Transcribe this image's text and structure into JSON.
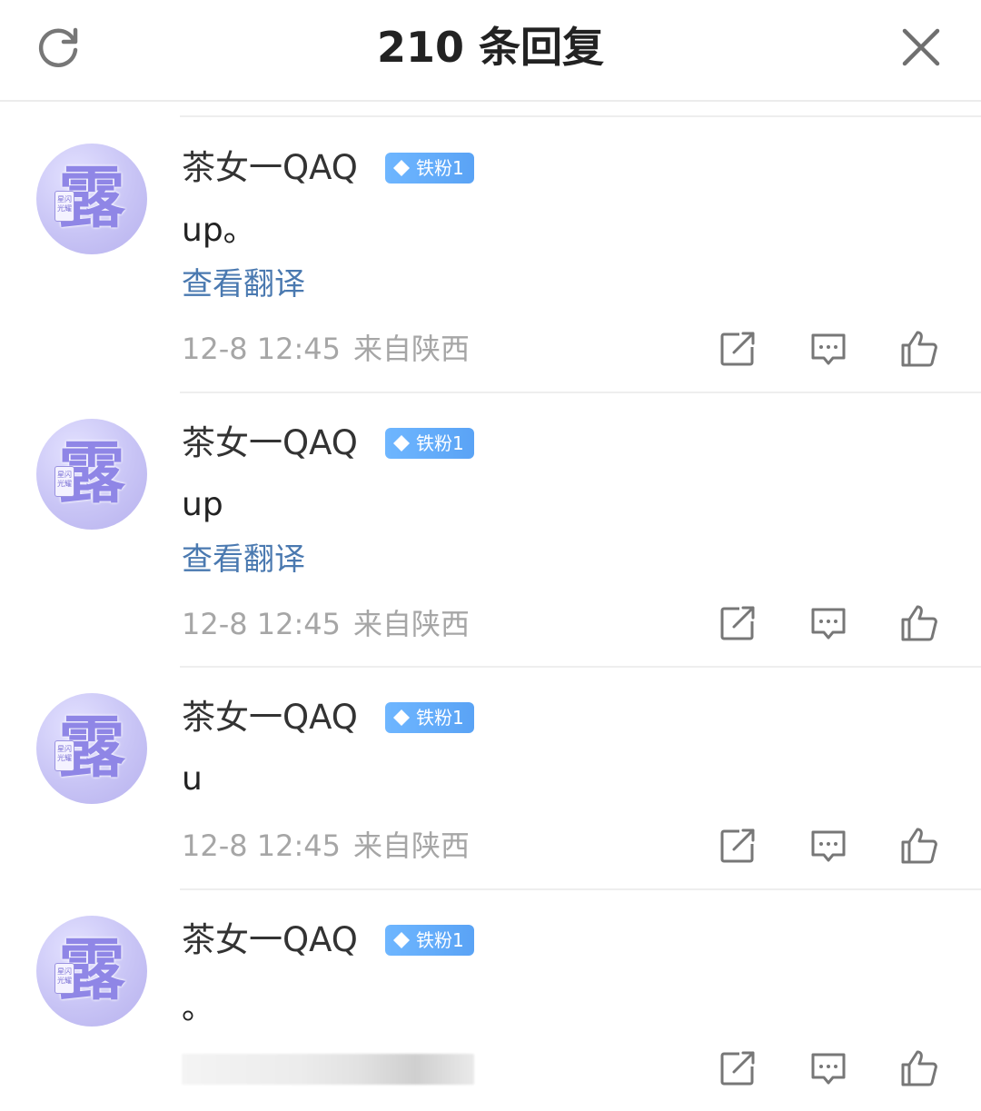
{
  "header": {
    "title": "210 条回复",
    "refresh_icon": "refresh-icon",
    "close_icon": "close-icon"
  },
  "colors": {
    "badge": "#5aa3f5",
    "link": "#4a79b0",
    "meta": "#a6a6a6",
    "avatar": "#c8c4f5"
  },
  "comments": [
    {
      "username": "茶女一QAQ",
      "badge": "铁粉1",
      "avatar_glyph": "露",
      "avatar_tag": "星闪光耀",
      "content": "up。",
      "translate": "查看翻译",
      "time": "12-8 12:45",
      "location": "来自陕西"
    },
    {
      "username": "茶女一QAQ",
      "badge": "铁粉1",
      "avatar_glyph": "露",
      "avatar_tag": "星闪光耀",
      "content": "up",
      "translate": "查看翻译",
      "time": "12-8 12:45",
      "location": "来自陕西"
    },
    {
      "username": "茶女一QAQ",
      "badge": "铁粉1",
      "avatar_glyph": "露",
      "avatar_tag": "星闪光耀",
      "content": "u",
      "time": "12-8 12:45",
      "location": "来自陕西"
    },
    {
      "username": "茶女一QAQ",
      "badge": "铁粉1",
      "avatar_glyph": "露",
      "avatar_tag": "星闪光耀",
      "content": "。"
    }
  ]
}
